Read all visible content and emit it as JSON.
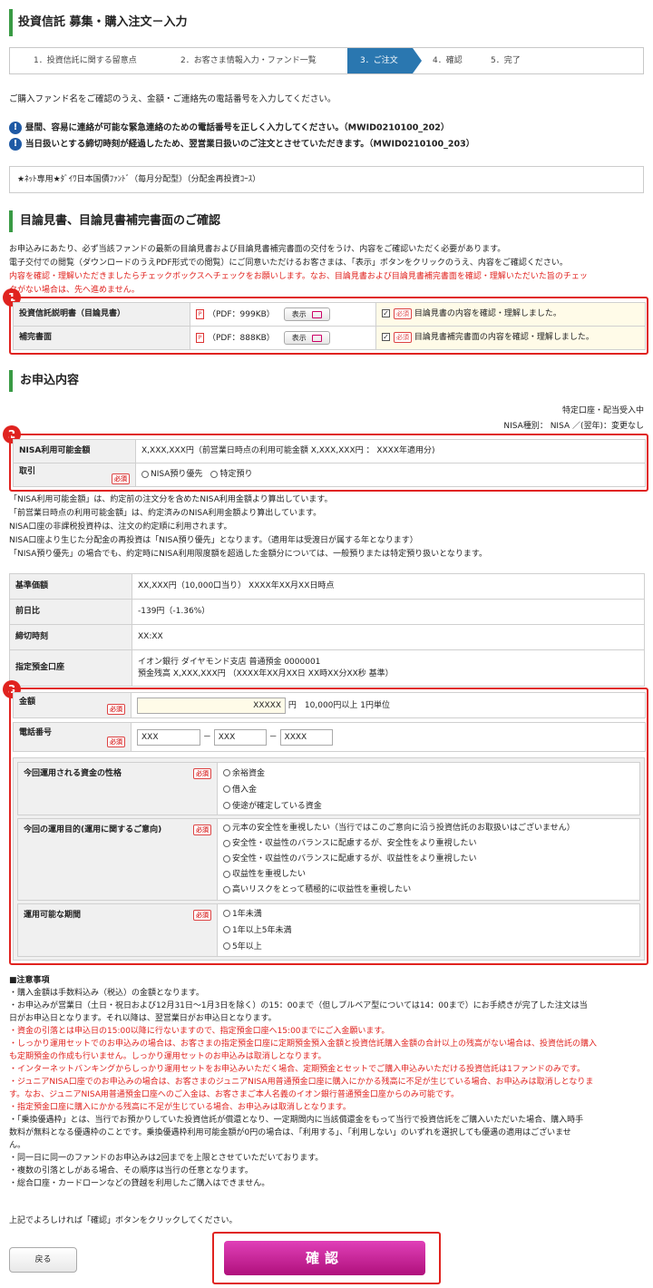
{
  "header": {
    "title": "投資信託 募集・購入注文－入力"
  },
  "steps": [
    {
      "label": "1．投資信託に関する留意点"
    },
    {
      "label": "2．お客さま情報入力・ファンド一覧"
    },
    {
      "label": "3．ご注文"
    },
    {
      "label": "4．確認"
    },
    {
      "label": "5．完了"
    }
  ],
  "intro": "ご購入ファンド名をご確認のうえ、金額・ご連絡先の電話番号を入力してください。",
  "warnings": [
    {
      "text": "昼間、容易に連絡が可能な緊急連絡のための電話番号を正しく入力してください。（MWID0210100_202）"
    },
    {
      "text": "当日扱いとする締切時刻が経過したため、翌営業日扱いのご注文とさせていただきます。（MWID0210100_203）"
    }
  ],
  "fund": {
    "name": "★ﾈｯﾄ専用★ﾀﾞｲﾜ日本国債ﾌｧﾝﾄﾞ（毎月分配型）（分配金再投資ｺｰｽ）"
  },
  "prospectus": {
    "title": "目論見書、目論見書補完書面のご確認",
    "desc1": "お申込みにあたり、必ず当該ファンドの最新の目論見書および目論見書補完書面の交付をうけ、内容をご確認いただく必要があります。",
    "desc2": "電子交付での閲覧（ダウンロードのうえPDF形式での閲覧）にご同意いただけるお客さまは、「表示」ボタンをクリックのうえ、内容をご確認ください。",
    "desc3": "内容を確認・理解いただきましたらチェックボックスへチェックをお願いします。なお、目論見書および目論見書補完書面を確認・理解いただいた旨のチェッ",
    "desc4": "クがない場合は、先へ進めません。",
    "view_label": "表示",
    "required": "必須",
    "rows": [
      {
        "label": "投資信託説明書（目論見書）",
        "size": "（PDF：999KB）",
        "check": "目論見書の内容を確認・理解しました。",
        "mark": "✓"
      },
      {
        "label": "補完書面",
        "size": "（PDF：888KB）",
        "check": "目論見書補完書面の内容を確認・理解しました。",
        "mark": "✓"
      }
    ]
  },
  "markers": {
    "m1": "1",
    "m2": "2",
    "m3": "3"
  },
  "application": {
    "title": "お申込内容",
    "account_type": "特定口座・配当受入中",
    "nisa_type": "NISA種別： NISA ／(翌年)：変更なし",
    "nisa_amount_label": "NISA利用可能金額",
    "nisa_amount_value": "X,XXX,XXX円（前営業日時点の利用可能金額 X,XXX,XXX円 ： XXXX年適用分)",
    "torihiki_label": "取引",
    "torihiki_opt1": "NISA預り優先",
    "torihiki_opt2": "特定預り",
    "notes": [
      "「NISA利用可能金額」は、約定前の注文分を含めたNISA利用金額より算出しています。",
      "「前営業日時点の利用可能金額」は、約定済みのNISA利用金額より算出しています。",
      "NISA口座の非課税投資枠は、注文の約定順に利用されます。",
      "NISA口座より生じた分配金の再投資は「NISA預り優先」となります。（適用年は受渡日が属する年となります）",
      "「NISA預り優先」の場合でも、約定時にNISA利用限度額を超過した金額分については、一般預りまたは特定預り扱いとなります。"
    ],
    "info": [
      {
        "label": "基準価額",
        "value": "XX,XXX円（10,000口当り） XXXX年XX月XX日時点"
      },
      {
        "label": "前日比",
        "value": "-139円（-1.36%）"
      },
      {
        "label": "締切時刻",
        "value": "XX:XX"
      },
      {
        "label": "指定預金口座",
        "value": "イオン銀行 ダイヤモンド支店 普通預金 0000001",
        "value2": "預金残高 X,XXX,XXX円 （XXXX年XX月XX日 XX時XX分XX秒 基準）"
      }
    ],
    "amount_label": "金額",
    "amount_value": "XXXXX",
    "amount_unit": "円",
    "amount_hint": "10,000円以上 1円単位",
    "phone_label": "電話番号",
    "phone1": "XXX",
    "phone2": "XXX",
    "phone3": "XXXX",
    "dash": "－",
    "q1": {
      "label": "今回運用される資金の性格",
      "options": [
        "余裕資金",
        "借入金",
        "使途が確定している資金"
      ]
    },
    "q2": {
      "label": "今回の運用目的(運用に関するご意向)",
      "options": [
        "元本の安全性を重視したい（当行ではこのご意向に沿う投資信託のお取扱いはございません）",
        "安全性・収益性のバランスに配慮するが、安全性をより重視したい",
        "安全性・収益性のバランスに配慮するが、収益性をより重視したい",
        "収益性を重視したい",
        "高いリスクをとって積極的に収益性を重視したい"
      ]
    },
    "q3": {
      "label": "運用可能な期間",
      "options": [
        "1年未満",
        "1年以上5年未満",
        "5年以上"
      ]
    }
  },
  "caution": {
    "title": "■注意事項",
    "lines": [
      {
        "t": "・購入金額は手数料込み（税込）の金額となります。",
        "red": false
      },
      {
        "t": "・お申込みが営業日（土日・祝日および12月31日～1月3日を除く）の15：00まで（但しブルベア型については14：00まで）にお手続きが完了した注文は当",
        "red": false
      },
      {
        "t": "日がお申込日となります。それ以降は、翌営業日がお申込日となります。",
        "red": false
      },
      {
        "t": "・資金の引落とは申込日の15:00以降に行ないますので、指定預金口座へ15:00までにご入金願います。",
        "red": true
      },
      {
        "t": "・しっかり運用セットでのお申込みの場合は、お客さまの指定預金口座に定期預金預入金額と投資信託購入金額の合計以上の残高がない場合は、投資信託の購入",
        "red": true
      },
      {
        "t": "も定期預金の作成も行いません。しっかり運用セットのお申込みは取消しとなります。",
        "red": true
      },
      {
        "t": "・インターネットバンキングからしっかり運用セットをお申込みいただく場合、定期預金とセットでご購入申込みいただける投資信託は1ファンドのみです。",
        "red": true
      },
      {
        "t": "・ジュニアNISA口座でのお申込みの場合は、お客さまのジュニアNISA用普通預金口座に購入にかかる残高に不足が生じている場合、お申込みは取消しとなりま",
        "red": true
      },
      {
        "t": "す。なお、ジュニアNISA用普通預金口座へのご入金は、お客さまご本人名義のイオン銀行普通預金口座からのみ可能です。",
        "red": true
      },
      {
        "t": "・指定預金口座に購入にかかる残高に不足が生じている場合、お申込みは取消しとなります。",
        "red": true
      },
      {
        "t": "・「乗換優遇枠」とは、当行でお預かりしていた投資信託が償還となり、一定期間内に当該償還金をもって当行で投資信託をご購入いただいた場合、購入時手",
        "red": false
      },
      {
        "t": "数料が無料となる優遇枠のことです。乗換優遇枠利用可能金額が0円の場合は、「利用する」、「利用しない」のいずれを選択しても優遇の適用はございませ",
        "red": false
      },
      {
        "t": "ん。",
        "red": false
      },
      {
        "t": "・同一日に同一のファンドのお申込みは2回までを上限とさせていただいております。",
        "red": false
      },
      {
        "t": "・複数の引落としがある場合、その順序は当行の任意となります。",
        "red": false
      },
      {
        "t": "・総合口座・カードローンなどの貸越を利用したご購入はできません。",
        "red": false
      }
    ],
    "footer": "上記でよろしければ「確認」ボタンをクリックしてください。"
  },
  "buttons": {
    "back": "戻る",
    "confirm": "確認"
  }
}
